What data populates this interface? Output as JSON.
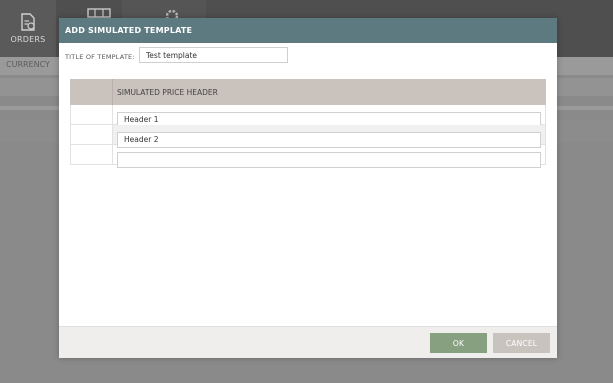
{
  "app": {
    "nav": {
      "orders_label": "ORDERS"
    },
    "subbar": {
      "currency_label": "CURRENCY"
    }
  },
  "modal": {
    "title": "ADD SIMULATED TEMPLATE",
    "template_title_label": "TITLE OF TEMPLATE:",
    "template_title_value": "Test template",
    "table": {
      "column_header": "SIMULATED PRICE HEADER",
      "rows": [
        {
          "value": "Header 1"
        },
        {
          "value": "Header 2"
        },
        {
          "value": ""
        }
      ]
    },
    "buttons": {
      "ok": "OK",
      "cancel": "CANCEL"
    }
  },
  "colors": {
    "modal_header": "#5c7a80",
    "ok_button": "#87a180",
    "cancel_button": "#c9c3be",
    "table_header": "#c9c2bd"
  }
}
